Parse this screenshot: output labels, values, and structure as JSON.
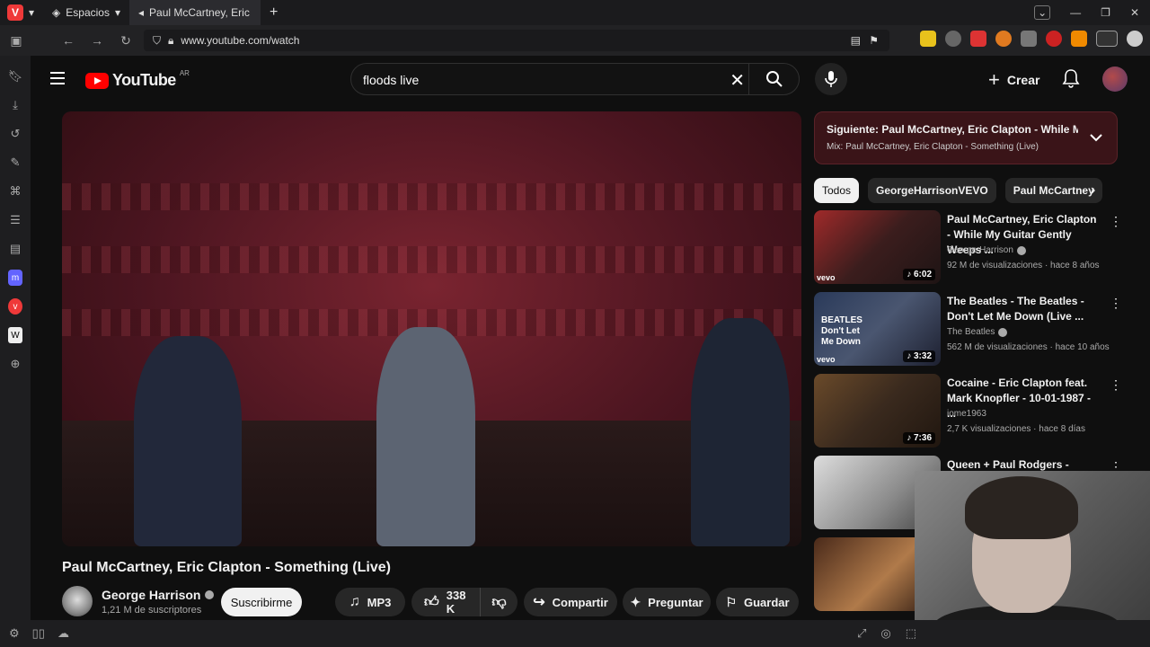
{
  "browser": {
    "workspaces_label": "Espacios",
    "tab_title": "Paul McCartney, Eric Clapton",
    "url": "www.youtube.com/watch"
  },
  "youtube": {
    "logo_text": "YouTube",
    "country_code": "AR",
    "search_query": "floods live",
    "create_label": "Crear"
  },
  "video": {
    "title": "Paul McCartney, Eric Clapton - Something (Live)",
    "channel": "George Harrison",
    "subscribers": "1,21 M de suscriptores",
    "subscribe_label": "Suscribirme",
    "mp3_label": "MP3",
    "likes": "338 K",
    "share_label": "Compartir",
    "ask_label": "Preguntar",
    "save_label": "Guardar"
  },
  "up_next": {
    "title": "Siguiente: Paul McCartney, Eric Clapton - While My ...",
    "subtitle": "Mix: Paul McCartney, Eric Clapton - Something (Live)"
  },
  "chips": [
    "Todos",
    "GeorgeHarrisonVEVO",
    "Paul McCartney"
  ],
  "recommendations": [
    {
      "title": "Paul McCartney, Eric Clapton - While My Guitar Gently Weeps ...",
      "channel": "George Harrison",
      "meta": "92 M de visualizaciones · hace 8 años",
      "duration": "6:02",
      "badge": "vevo"
    },
    {
      "title": "The Beatles - The Beatles - Don't Let Me Down (Live ...",
      "channel": "The Beatles",
      "meta": "562 M de visualizaciones · hace 10 años",
      "duration": "3:32",
      "badge": "vevo"
    },
    {
      "title": "Cocaine - Eric Clapton feat. Mark Knopfler - 10-01-1987 - ...",
      "channel": "iome1963",
      "meta": "2,7 K visualizaciones · hace 8 días",
      "duration": "7:36",
      "badge": ""
    },
    {
      "title": "Queen + Paul Rodgers -",
      "channel": "",
      "meta": "",
      "duration": "",
      "badge": ""
    }
  ],
  "colors": {
    "background": "#0f0f0f",
    "youtube_red": "#ff0000",
    "up_next_bg": "#3a1418",
    "chip_bg": "#272727"
  }
}
